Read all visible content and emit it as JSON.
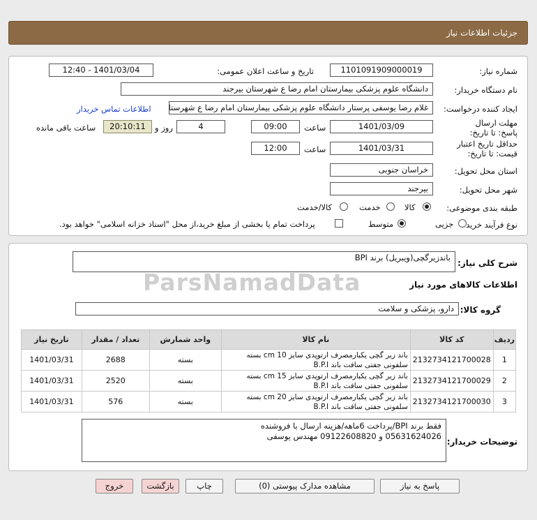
{
  "header": {
    "title": "جزئیات اطلاعات نیاز"
  },
  "form": {
    "need_number_label": "شماره نیاز:",
    "need_number": "1101091909000019",
    "announce_label": "تاریخ و ساعت اعلان عمومی:",
    "announce_value": "1401/03/04 - 12:40",
    "buyer_org_label": "نام دستگاه خریدار:",
    "buyer_org": "دانشگاه علوم پزشکی  بیمارستان امام رضا ع  شهرستان بیرجند",
    "requester_label": "ایجاد کننده درخواست:",
    "requester": "غلام رضا یوسفی پرستار دانشگاه علوم پزشکی  بیمارستان امام رضا ع  شهرستان بیرجند",
    "contact_link": "اطلاعات تماس خریدار",
    "deadline_label": "مهلت ارسال پاسخ: تا تاریخ:",
    "deadline_date": "1401/03/09",
    "time_label": "ساعت",
    "deadline_time": "09:00",
    "days_value": "4",
    "days_label": "روز و",
    "remaining_time": "20:10:11",
    "remaining_label": "ساعت باقی مانده",
    "validity_label": "حداقل تاریخ اعتبار قیمت: تا تاریخ:",
    "validity_date": "1401/03/31",
    "validity_time": "12:00",
    "province_label": "استان محل تحویل:",
    "province": "خراسان جنوبی",
    "city_label": "شهر محل تحویل:",
    "city": "بیرجند",
    "category_label": "طبقه بندی موضوعی:",
    "category_options": [
      "کالا",
      "خدمت",
      "کالا/خدمت"
    ],
    "process_label": "نوع فرآیند خرید :",
    "process_options": [
      "جزیی",
      "متوسط"
    ],
    "payment_note": "پرداخت تمام یا بخشی از مبلغ خرید،از محل \"اسناد خزانه اسلامی\" خواهد بود."
  },
  "details": {
    "summary_label": "شرح کلی نیاز:",
    "summary": "باندزیرگچی(ویبریل) برند BPI",
    "goods_info_title": "اطلاعات کالاهای مورد نیاز",
    "goods_group_label": "گروه کالا:",
    "goods_group": "دارو، پزشکی و سلامت",
    "columns": [
      "ردیف",
      "کد کالا",
      "نام کالا",
      "واحد شمارش",
      "تعداد / مقدار",
      "تاریخ نیاز"
    ],
    "rows": [
      {
        "idx": "1",
        "code": "2132734121700028",
        "name": "باند زیر گچی یکبارمصرف ارتوپدی سایز cm 10 بسته سلفونی جفتی سافت باند B.P.I",
        "unit": "بسته",
        "qty": "2688",
        "date": "1401/03/31"
      },
      {
        "idx": "2",
        "code": "2132734121700029",
        "name": "باند زیر گچی یکبارمصرف ارتوپدی سایز cm 15 بسته سلفونی جفتی سافت باند B.P.I",
        "unit": "بسته",
        "qty": "2520",
        "date": "1401/03/31"
      },
      {
        "idx": "3",
        "code": "2132734121700030",
        "name": "باند زیر گچی یکبارمصرف ارتوپدی سایز cm 20 بسته سلفونی جفتی سافت باند B.P.I",
        "unit": "بسته",
        "qty": "576",
        "date": "1401/03/31"
      }
    ],
    "buyer_notes_label": "توضیحات خریدار:",
    "buyer_notes_line1": "فقط برند BPI/پرداخت 6ماهه/هزینه ارسال با فروشنده",
    "buyer_notes_line2": "05631624026 و 09122608820 مهندس یوسفی"
  },
  "buttons": {
    "reply": "پاسخ به نیاز",
    "attachments": "مشاهده مدارک پیوستی (0)",
    "print": "چاپ",
    "back": "بازگشت",
    "exit": "خروج"
  },
  "watermark": {
    "text": "ParsNamadData"
  }
}
